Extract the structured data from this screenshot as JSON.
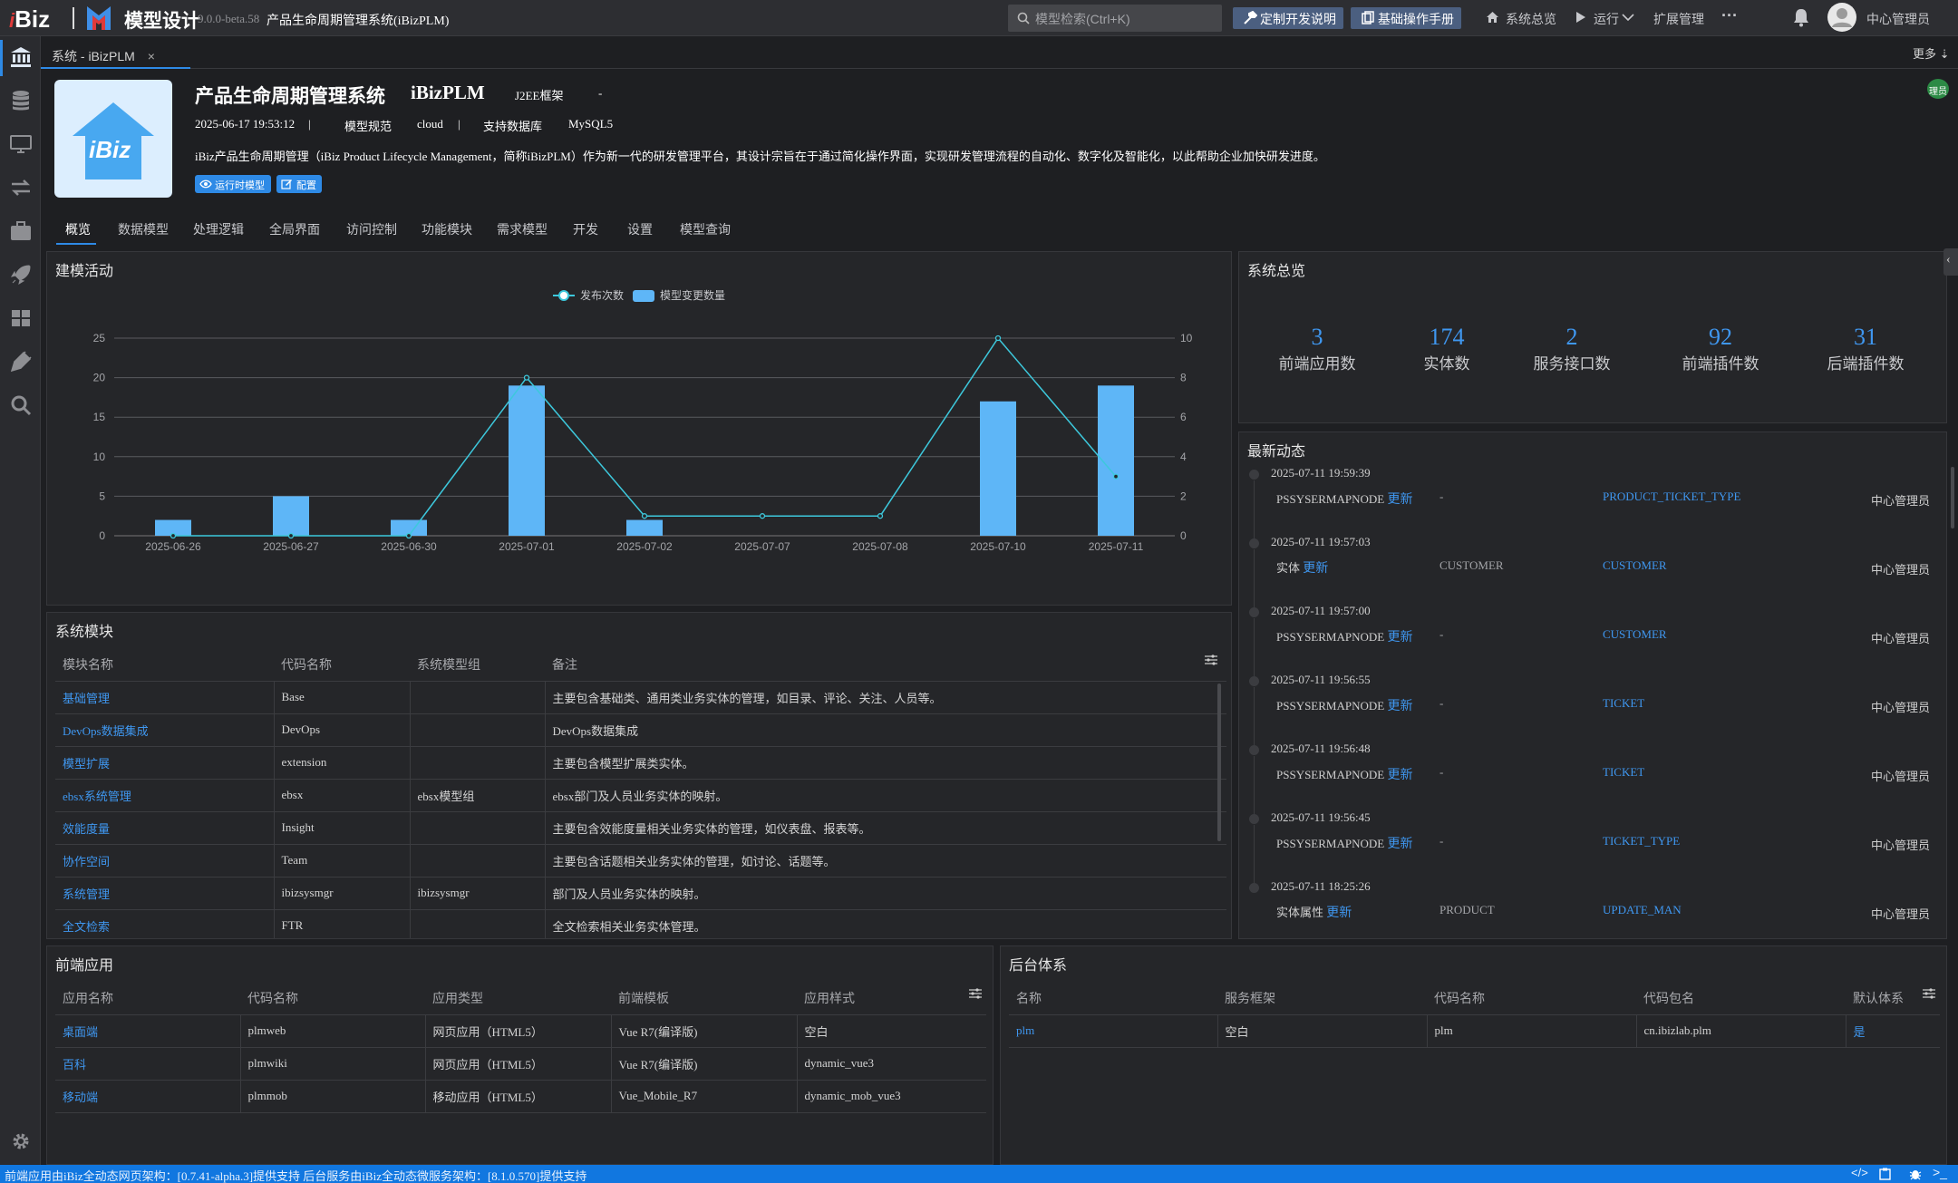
{
  "topbar": {
    "brand_prefix": "i",
    "brand_main": "Biz",
    "app_name": "模型设计",
    "version": "9.0.0-beta.58",
    "system_name": "产品生命周期管理系统(iBizPLM)",
    "search_placeholder": "模型检索(Ctrl+K)",
    "custom_dev_label": "定制开发说明",
    "manual_label": "基础操作手册",
    "overview_label": "系统总览",
    "run_label": "运行",
    "ext_label": "扩展管理",
    "more_label": "···",
    "user_label": "中心管理员"
  },
  "tabbar": {
    "active_tab": "系统 - iBizPLM",
    "more_label": "更多"
  },
  "header": {
    "logo_text": "iBiz",
    "title": "产品生命周期管理系统",
    "code": "iBizPLM",
    "framework": "J2EE框架",
    "framework_extra": "-",
    "updated": "2025-06-17 19:53:12",
    "sep": "|",
    "spec_label": "模型规范",
    "spec_value": "cloud",
    "db_label": "支持数据库",
    "db_value": "MySQL5",
    "description": "iBiz产品生命周期管理（iBiz Product Lifecycle Management，简称iBizPLM）作为新一代的研发管理平台，其设计宗旨在于通过简化操作界面，实现研发管理流程的自动化、数字化及智能化，以此帮助企业加快研发进度。",
    "runtime_btn": "运行时模型",
    "config_btn": "配置",
    "badge": "理员"
  },
  "nav_tabs": [
    "概览",
    "数据模型",
    "处理逻辑",
    "全局界面",
    "访问控制",
    "功能模块",
    "需求模型",
    "开发",
    "设置",
    "模型查询"
  ],
  "activity": {
    "title": "建模活动"
  },
  "chart_data": {
    "type": "bar",
    "categories": [
      "2025-06-26",
      "2025-06-27",
      "2025-06-30",
      "2025-07-01",
      "2025-07-02",
      "2025-07-07",
      "2025-07-08",
      "2025-07-10",
      "2025-07-11"
    ],
    "series": [
      {
        "name": "模型变更数量",
        "type": "bar",
        "axis": "left",
        "values": [
          2,
          5,
          2,
          19,
          2,
          0,
          0,
          17,
          19
        ]
      },
      {
        "name": "发布次数",
        "type": "line",
        "axis": "right",
        "values": [
          0,
          0,
          0,
          8,
          1,
          1,
          1,
          10,
          3
        ]
      }
    ],
    "ylim_left": [
      0,
      25
    ],
    "yticks_left": [
      0,
      5,
      10,
      15,
      20,
      25
    ],
    "ylim_right": [
      0,
      10
    ],
    "yticks_right": [
      0,
      2,
      4,
      6,
      8,
      10
    ],
    "legend": "top-center",
    "grid": true,
    "colors": {
      "bar": "#5eb6f7",
      "line": "#3dc8dc"
    }
  },
  "overview": {
    "title": "系统总览",
    "stats": [
      {
        "num": "3",
        "label": "前端应用数"
      },
      {
        "num": "174",
        "label": "实体数"
      },
      {
        "num": "2",
        "label": "服务接口数"
      },
      {
        "num": "92",
        "label": "前端插件数"
      },
      {
        "num": "31",
        "label": "后端插件数"
      }
    ]
  },
  "feed": {
    "title": "最新动态",
    "items": [
      {
        "time": "2025-07-11 19:59:39",
        "kind": "PSSYSERMAPNODE",
        "action": "更新",
        "mid": "-",
        "obj": "PRODUCT_TICKET_TYPE",
        "user": "中心管理员"
      },
      {
        "time": "2025-07-11 19:57:03",
        "kind": "实体",
        "action": "更新",
        "mid": "CUSTOMER",
        "obj": "CUSTOMER",
        "user": "中心管理员"
      },
      {
        "time": "2025-07-11 19:57:00",
        "kind": "PSSYSERMAPNODE",
        "action": "更新",
        "mid": "-",
        "obj": "CUSTOMER",
        "user": "中心管理员"
      },
      {
        "time": "2025-07-11 19:56:55",
        "kind": "PSSYSERMAPNODE",
        "action": "更新",
        "mid": "-",
        "obj": "TICKET",
        "user": "中心管理员"
      },
      {
        "time": "2025-07-11 19:56:48",
        "kind": "PSSYSERMAPNODE",
        "action": "更新",
        "mid": "-",
        "obj": "TICKET",
        "user": "中心管理员"
      },
      {
        "time": "2025-07-11 19:56:45",
        "kind": "PSSYSERMAPNODE",
        "action": "更新",
        "mid": "-",
        "obj": "TICKET_TYPE",
        "user": "中心管理员"
      },
      {
        "time": "2025-07-11 18:25:26",
        "kind": "实体属性",
        "action": "更新",
        "mid": "PRODUCT",
        "obj": "UPDATE_MAN",
        "user": "中心管理员"
      }
    ]
  },
  "modules": {
    "title": "系统模块",
    "columns": [
      "模块名称",
      "代码名称",
      "系统模型组",
      "备注"
    ],
    "rows": [
      [
        "基础管理",
        "Base",
        "",
        "主要包含基础类、通用类业务实体的管理，如目录、评论、关注、人员等。"
      ],
      [
        "DevOps数据集成",
        "DevOps",
        "",
        "DevOps数据集成"
      ],
      [
        "模型扩展",
        "extension",
        "",
        "主要包含模型扩展类实体。"
      ],
      [
        "ebsx系统管理",
        "ebsx",
        "ebsx模型组",
        "ebsx部门及人员业务实体的映射。"
      ],
      [
        "效能度量",
        "Insight",
        "",
        "主要包含效能度量相关业务实体的管理，如仪表盘、报表等。"
      ],
      [
        "协作空间",
        "Team",
        "",
        "主要包含话题相关业务实体的管理，如讨论、话题等。"
      ],
      [
        "系统管理",
        "ibizsysmgr",
        "ibizsysmgr",
        "部门及人员业务实体的映射。"
      ],
      [
        "全文检索",
        "FTR",
        "",
        "全文检索相关业务实体管理。"
      ]
    ]
  },
  "frontend": {
    "title": "前端应用",
    "columns": [
      "应用名称",
      "代码名称",
      "应用类型",
      "前端模板",
      "应用样式"
    ],
    "rows": [
      [
        "桌面端",
        "plmweb",
        "网页应用（HTML5）",
        "Vue R7(编译版)",
        "空白"
      ],
      [
        "百科",
        "plmwiki",
        "网页应用（HTML5）",
        "Vue R7(编译版)",
        "dynamic_vue3"
      ],
      [
        "移动端",
        "plmmob",
        "移动应用（HTML5）",
        "Vue_Mobile_R7",
        "dynamic_mob_vue3"
      ]
    ]
  },
  "backend": {
    "title": "后台体系",
    "columns": [
      "名称",
      "服务框架",
      "代码名称",
      "代码包名",
      "默认体系"
    ],
    "rows": [
      [
        "plm",
        "空白",
        "plm",
        "cn.ibizlab.plm",
        "是"
      ]
    ]
  },
  "statusbar": {
    "text": "前端应用由iBiz全动态网页架构：[0.7.41-alpha.3]提供支持 后台服务由iBiz全动态微服务架构：[8.1.0.570]提供支持"
  }
}
